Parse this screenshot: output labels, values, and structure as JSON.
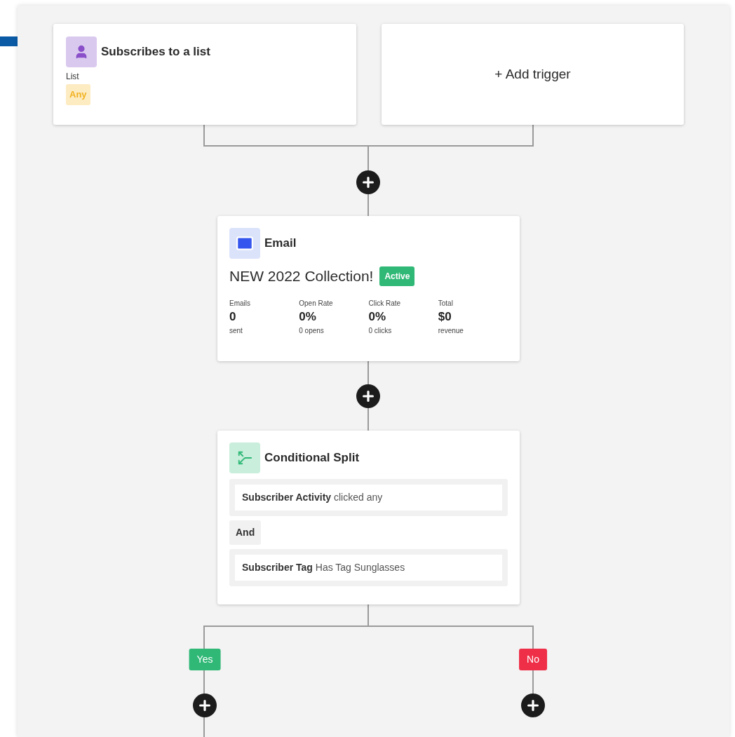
{
  "triggers": [
    {
      "kind": "trigger",
      "title": "Subscribes to a list",
      "field_label": "List",
      "field_value": "Any"
    },
    {
      "kind": "add",
      "label": "+ Add trigger"
    }
  ],
  "email": {
    "type": "Email",
    "subject": "NEW 2022 Collection!",
    "status": "Active",
    "stats": [
      {
        "label": "Emails",
        "value": "0",
        "unit": "sent"
      },
      {
        "label": "Open Rate",
        "value": "0%",
        "unit": "0 opens"
      },
      {
        "label": "Click Rate",
        "value": "0%",
        "unit": "0 clicks"
      },
      {
        "label": "Total",
        "value": "$0",
        "unit": "revenue"
      }
    ]
  },
  "split": {
    "type": "Conditional Split",
    "conditions": [
      {
        "field": "Subscriber Activity",
        "rule": "clicked any"
      },
      {
        "field": "Subscriber Tag",
        "rule": "Has Tag Sunglasses"
      }
    ],
    "joiner": "And"
  },
  "branches": [
    {
      "label": "Yes",
      "color": "#2fb876"
    },
    {
      "label": "No",
      "color": "#ef2f48"
    }
  ]
}
